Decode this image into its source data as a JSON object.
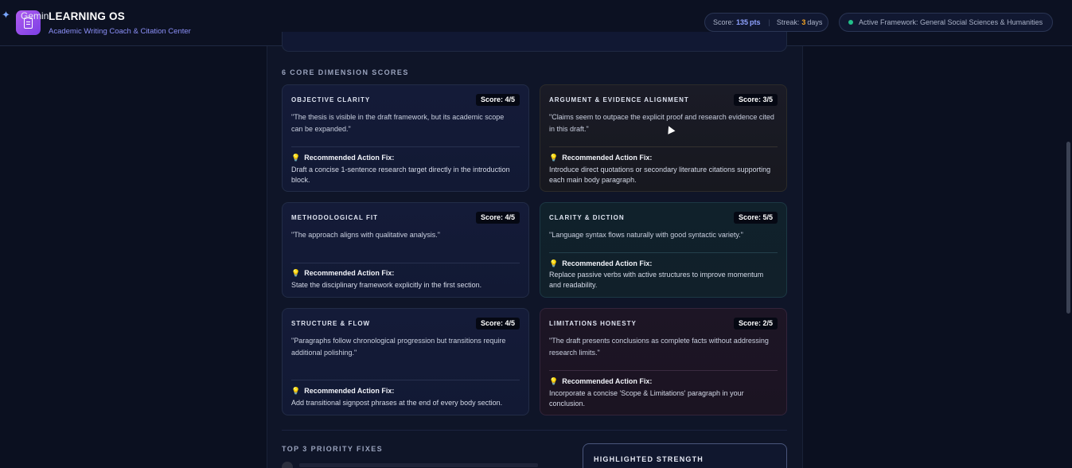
{
  "header": {
    "assistant_label": "Gemini",
    "app_title": "LEARNING OS",
    "app_subtitle": "Academic Writing Coach & Citation Center",
    "stats": {
      "score_label": "Score:",
      "score_value": "135",
      "score_unit": "pts",
      "streak_label": "Streak:",
      "streak_value": "3",
      "streak_unit": "days"
    },
    "framework": "Active Framework: General Social Sciences & Humanities"
  },
  "dimensions_section": {
    "title": "6 CORE DIMENSION SCORES",
    "fix_label": "Recommended Action Fix:",
    "cards": [
      {
        "name": "OBJECTIVE CLARITY",
        "score": "Score: 4/5",
        "quote": "\"The thesis is visible in the draft framework, but its academic scope can be expanded.\"",
        "fix": "Draft a concise 1-sentence research target directly in the introduction block."
      },
      {
        "name": "ARGUMENT & EVIDENCE ALIGNMENT",
        "score": "Score: 3/5",
        "quote": "\"Claims seem to outpace the explicit proof and research evidence cited in this draft.\"",
        "fix": "Introduce direct quotations or secondary literature citations supporting each main body paragraph."
      },
      {
        "name": "METHODOLOGICAL FIT",
        "score": "Score: 4/5",
        "quote": "\"The approach aligns with qualitative analysis.\"",
        "fix": "State the disciplinary framework explicitly in the first section."
      },
      {
        "name": "CLARITY & DICTION",
        "score": "Score: 5/5",
        "quote": "\"Language syntax flows naturally with good syntactic variety.\"",
        "fix": "Replace passive verbs with active structures to improve momentum and readability."
      },
      {
        "name": "STRUCTURE & FLOW",
        "score": "Score: 4/5",
        "quote": "\"Paragraphs follow chronological progression but transitions require additional polishing.\"",
        "fix": "Add transitional signpost phrases at the end of every body section."
      },
      {
        "name": "LIMITATIONS HONESTY",
        "score": "Score: 2/5",
        "quote": "\"The draft presents conclusions as complete facts without addressing research limits.\"",
        "fix": "Incorporate a concise 'Scope & Limitations' paragraph in your conclusion."
      }
    ]
  },
  "priority_section": {
    "title": "TOP 3 PRIORITY FIXES"
  },
  "strength_section": {
    "title": "HIGHLIGHTED STRENGTH"
  }
}
